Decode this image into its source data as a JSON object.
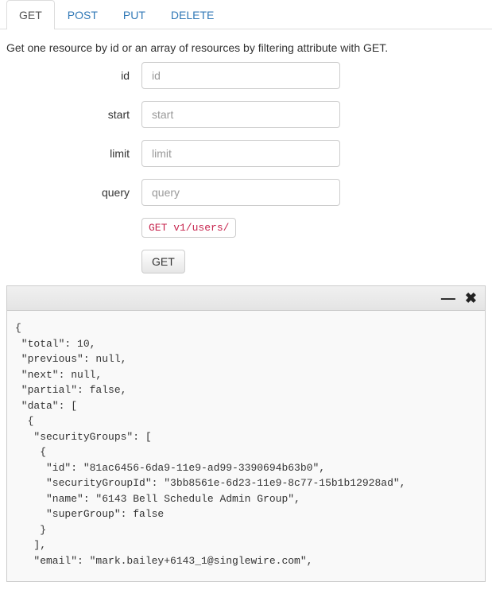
{
  "tabs": {
    "get": "GET",
    "post": "POST",
    "put": "PUT",
    "delete": "DELETE"
  },
  "description": "Get one resource by id or an array of resources by filtering attribute with GET.",
  "form": {
    "id": {
      "label": "id",
      "placeholder": "id"
    },
    "start": {
      "label": "start",
      "placeholder": "start"
    },
    "limit": {
      "label": "limit",
      "placeholder": "limit"
    },
    "query": {
      "label": "query",
      "placeholder": "query"
    }
  },
  "endpoint": "GET v1/users/",
  "submit_label": "GET",
  "response_text": "{\n \"total\": 10,\n \"previous\": null,\n \"next\": null,\n \"partial\": false,\n \"data\": [\n  {\n   \"securityGroups\": [\n    {\n     \"id\": \"81ac6456-6da9-11e9-ad99-3390694b63b0\",\n     \"securityGroupId\": \"3bb8561e-6d23-11e9-8c77-15b1b12928ad\",\n     \"name\": \"6143 Bell Schedule Admin Group\",\n     \"superGroup\": false\n    }\n   ],\n   \"email\": \"mark.bailey+6143_1@singlewire.com\","
}
